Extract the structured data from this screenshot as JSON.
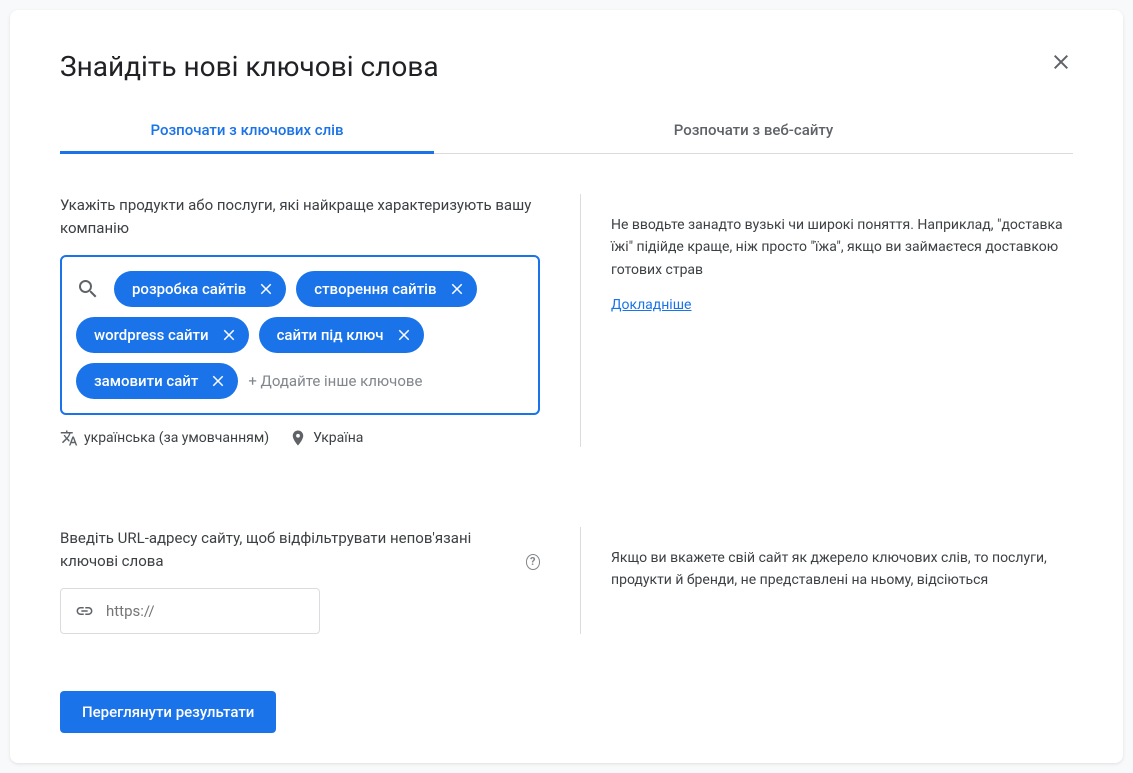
{
  "dialog": {
    "title": "Знайдіть нові ключові слова"
  },
  "tabs": {
    "keywords": "Розпочати з ключових слів",
    "website": "Розпочати з веб-сайту"
  },
  "keywords_section": {
    "label": "Укажіть продукти або послуги, які найкраще характеризують вашу компанію",
    "chips": [
      "розробка сайтів",
      "створення сайтів",
      "wordpress сайти",
      "сайти під ключ",
      "замовити сайт"
    ],
    "add_placeholder": "+ Додайте інше ключове",
    "language": "українська (за умовчанням)",
    "location": "Україна",
    "help_text": "Не вводьте занадто вузькі чи широкі поняття. Наприклад, \"доставка їжі\" підійде краще, ніж просто \"їжа\", якщо ви займаєтеся доставкою готових страв",
    "learn_more": "Докладніше"
  },
  "url_section": {
    "label": "Введіть URL-адресу сайту, щоб відфільтрувати непов'язані ключові слова",
    "placeholder": "https://",
    "help_text": "Якщо ви вкажете свій сайт як джерело ключових слів, то послуги, продукти й бренди, не представлені на ньому, відсіються"
  },
  "submit": {
    "label": "Переглянути результати"
  }
}
